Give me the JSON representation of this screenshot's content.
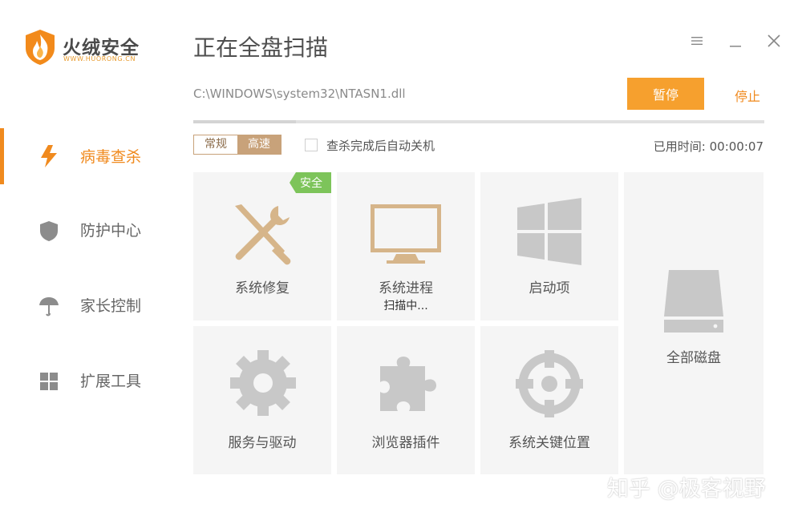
{
  "app": {
    "name": "火绒安全",
    "site": "WWW.HUORONG.CN"
  },
  "sidebar": {
    "items": [
      {
        "label": "病毒查杀",
        "icon": "lightning-icon",
        "active": true
      },
      {
        "label": "防护中心",
        "icon": "shield-icon",
        "active": false
      },
      {
        "label": "家长控制",
        "icon": "umbrella-icon",
        "active": false
      },
      {
        "label": "扩展工具",
        "icon": "grid-icon",
        "active": false
      }
    ]
  },
  "header": {
    "title": "正在全盘扫描",
    "window_controls": [
      "menu-icon",
      "minimize-icon",
      "close-icon"
    ]
  },
  "scan": {
    "current_file": "C:\\WINDOWS\\system32\\NTASN1.dll",
    "pause_label": "暂停",
    "stop_label": "停止",
    "progress": 0.18
  },
  "options": {
    "modes": [
      "常规",
      "高速"
    ],
    "selected_mode": "高速",
    "auto_shutdown_label": "查杀完成后自动关机",
    "auto_shutdown_checked": false,
    "elapsed_label": "已用时间:",
    "elapsed_value": "00:00:07"
  },
  "tiles": [
    {
      "label": "系统修复",
      "icon": "repair-tools-icon",
      "badge": "安全",
      "status": ""
    },
    {
      "label": "系统进程",
      "icon": "monitor-icon",
      "badge": "",
      "status": "扫描中..."
    },
    {
      "label": "启动项",
      "icon": "windows-icon",
      "badge": "",
      "status": ""
    },
    {
      "label": "服务与驱动",
      "icon": "gear-icon",
      "badge": "",
      "status": ""
    },
    {
      "label": "浏览器插件",
      "icon": "puzzle-icon",
      "badge": "",
      "status": ""
    },
    {
      "label": "系统关键位置",
      "icon": "target-icon",
      "badge": "",
      "status": ""
    },
    {
      "label": "全部磁盘",
      "icon": "hard-disk-icon",
      "badge": "",
      "status": ""
    }
  ],
  "colors": {
    "accent": "#f08a1e",
    "pause_button": "#f6a02e",
    "badge_green": "#7dc45a",
    "tool_tan": "#d6b58a"
  },
  "watermark": "知乎 @极客视野"
}
